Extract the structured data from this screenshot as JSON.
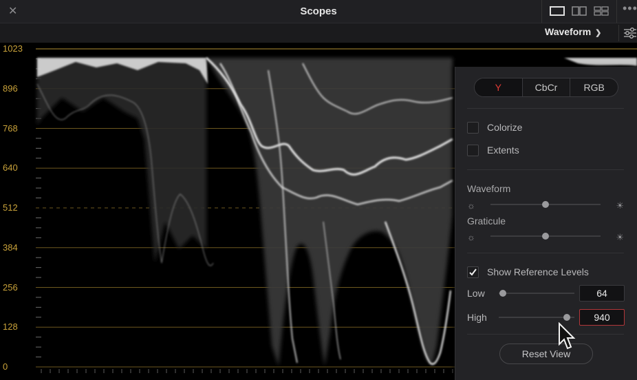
{
  "window": {
    "title": "Scopes",
    "close_icon": "close-icon",
    "layout_icons": [
      "single-view-icon",
      "dual-view-icon",
      "quad-view-icon"
    ],
    "more_icon": "more-options-icon"
  },
  "toolbar": {
    "scope_type": "Waveform",
    "settings_icon": "settings-sliders-icon"
  },
  "scope": {
    "axis_labels": [
      "1023",
      "896",
      "768",
      "640",
      "512",
      "384",
      "256",
      "128",
      "0"
    ],
    "graticule_color": "#c9a23a"
  },
  "panel": {
    "modes": [
      "Y",
      "CbCr",
      "RGB"
    ],
    "active_mode": "Y",
    "colorize": {
      "label": "Colorize",
      "checked": false
    },
    "extents": {
      "label": "Extents",
      "checked": false
    },
    "waveform": {
      "label": "Waveform",
      "level": 0.5
    },
    "graticule": {
      "label": "Graticule",
      "level": 0.5
    },
    "show_reference_levels": {
      "label": "Show Reference Levels",
      "checked": true
    },
    "low": {
      "label": "Low",
      "value": "64"
    },
    "high": {
      "label": "High",
      "value": "940"
    },
    "reset_label": "Reset View"
  }
}
